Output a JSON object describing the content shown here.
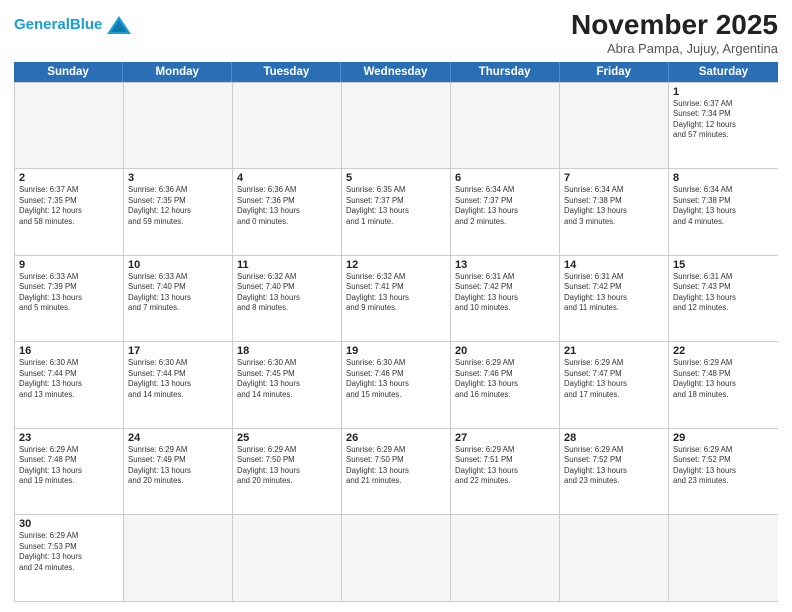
{
  "header": {
    "logo_general": "General",
    "logo_blue": "Blue",
    "month": "November 2025",
    "location": "Abra Pampa, Jujuy, Argentina"
  },
  "weekdays": [
    "Sunday",
    "Monday",
    "Tuesday",
    "Wednesday",
    "Thursday",
    "Friday",
    "Saturday"
  ],
  "rows": [
    [
      {
        "day": "",
        "info": ""
      },
      {
        "day": "",
        "info": ""
      },
      {
        "day": "",
        "info": ""
      },
      {
        "day": "",
        "info": ""
      },
      {
        "day": "",
        "info": ""
      },
      {
        "day": "",
        "info": ""
      },
      {
        "day": "1",
        "info": "Sunrise: 6:37 AM\nSunset: 7:34 PM\nDaylight: 12 hours\nand 57 minutes."
      }
    ],
    [
      {
        "day": "2",
        "info": "Sunrise: 6:37 AM\nSunset: 7:35 PM\nDaylight: 12 hours\nand 58 minutes."
      },
      {
        "day": "3",
        "info": "Sunrise: 6:36 AM\nSunset: 7:35 PM\nDaylight: 12 hours\nand 59 minutes."
      },
      {
        "day": "4",
        "info": "Sunrise: 6:36 AM\nSunset: 7:36 PM\nDaylight: 13 hours\nand 0 minutes."
      },
      {
        "day": "5",
        "info": "Sunrise: 6:35 AM\nSunset: 7:37 PM\nDaylight: 13 hours\nand 1 minute."
      },
      {
        "day": "6",
        "info": "Sunrise: 6:34 AM\nSunset: 7:37 PM\nDaylight: 13 hours\nand 2 minutes."
      },
      {
        "day": "7",
        "info": "Sunrise: 6:34 AM\nSunset: 7:38 PM\nDaylight: 13 hours\nand 3 minutes."
      },
      {
        "day": "8",
        "info": "Sunrise: 6:34 AM\nSunset: 7:38 PM\nDaylight: 13 hours\nand 4 minutes."
      }
    ],
    [
      {
        "day": "9",
        "info": "Sunrise: 6:33 AM\nSunset: 7:39 PM\nDaylight: 13 hours\nand 5 minutes."
      },
      {
        "day": "10",
        "info": "Sunrise: 6:33 AM\nSunset: 7:40 PM\nDaylight: 13 hours\nand 7 minutes."
      },
      {
        "day": "11",
        "info": "Sunrise: 6:32 AM\nSunset: 7:40 PM\nDaylight: 13 hours\nand 8 minutes."
      },
      {
        "day": "12",
        "info": "Sunrise: 6:32 AM\nSunset: 7:41 PM\nDaylight: 13 hours\nand 9 minutes."
      },
      {
        "day": "13",
        "info": "Sunrise: 6:31 AM\nSunset: 7:42 PM\nDaylight: 13 hours\nand 10 minutes."
      },
      {
        "day": "14",
        "info": "Sunrise: 6:31 AM\nSunset: 7:42 PM\nDaylight: 13 hours\nand 11 minutes."
      },
      {
        "day": "15",
        "info": "Sunrise: 6:31 AM\nSunset: 7:43 PM\nDaylight: 13 hours\nand 12 minutes."
      }
    ],
    [
      {
        "day": "16",
        "info": "Sunrise: 6:30 AM\nSunset: 7:44 PM\nDaylight: 13 hours\nand 13 minutes."
      },
      {
        "day": "17",
        "info": "Sunrise: 6:30 AM\nSunset: 7:44 PM\nDaylight: 13 hours\nand 14 minutes."
      },
      {
        "day": "18",
        "info": "Sunrise: 6:30 AM\nSunset: 7:45 PM\nDaylight: 13 hours\nand 14 minutes."
      },
      {
        "day": "19",
        "info": "Sunrise: 6:30 AM\nSunset: 7:46 PM\nDaylight: 13 hours\nand 15 minutes."
      },
      {
        "day": "20",
        "info": "Sunrise: 6:29 AM\nSunset: 7:46 PM\nDaylight: 13 hours\nand 16 minutes."
      },
      {
        "day": "21",
        "info": "Sunrise: 6:29 AM\nSunset: 7:47 PM\nDaylight: 13 hours\nand 17 minutes."
      },
      {
        "day": "22",
        "info": "Sunrise: 6:29 AM\nSunset: 7:48 PM\nDaylight: 13 hours\nand 18 minutes."
      }
    ],
    [
      {
        "day": "23",
        "info": "Sunrise: 6:29 AM\nSunset: 7:48 PM\nDaylight: 13 hours\nand 19 minutes."
      },
      {
        "day": "24",
        "info": "Sunrise: 6:29 AM\nSunset: 7:49 PM\nDaylight: 13 hours\nand 20 minutes."
      },
      {
        "day": "25",
        "info": "Sunrise: 6:29 AM\nSunset: 7:50 PM\nDaylight: 13 hours\nand 20 minutes."
      },
      {
        "day": "26",
        "info": "Sunrise: 6:29 AM\nSunset: 7:50 PM\nDaylight: 13 hours\nand 21 minutes."
      },
      {
        "day": "27",
        "info": "Sunrise: 6:29 AM\nSunset: 7:51 PM\nDaylight: 13 hours\nand 22 minutes."
      },
      {
        "day": "28",
        "info": "Sunrise: 6:29 AM\nSunset: 7:52 PM\nDaylight: 13 hours\nand 23 minutes."
      },
      {
        "day": "29",
        "info": "Sunrise: 6:29 AM\nSunset: 7:52 PM\nDaylight: 13 hours\nand 23 minutes."
      }
    ],
    [
      {
        "day": "30",
        "info": "Sunrise: 6:29 AM\nSunset: 7:53 PM\nDaylight: 13 hours\nand 24 minutes."
      },
      {
        "day": "",
        "info": ""
      },
      {
        "day": "",
        "info": ""
      },
      {
        "day": "",
        "info": ""
      },
      {
        "day": "",
        "info": ""
      },
      {
        "day": "",
        "info": ""
      },
      {
        "day": "",
        "info": ""
      }
    ]
  ]
}
